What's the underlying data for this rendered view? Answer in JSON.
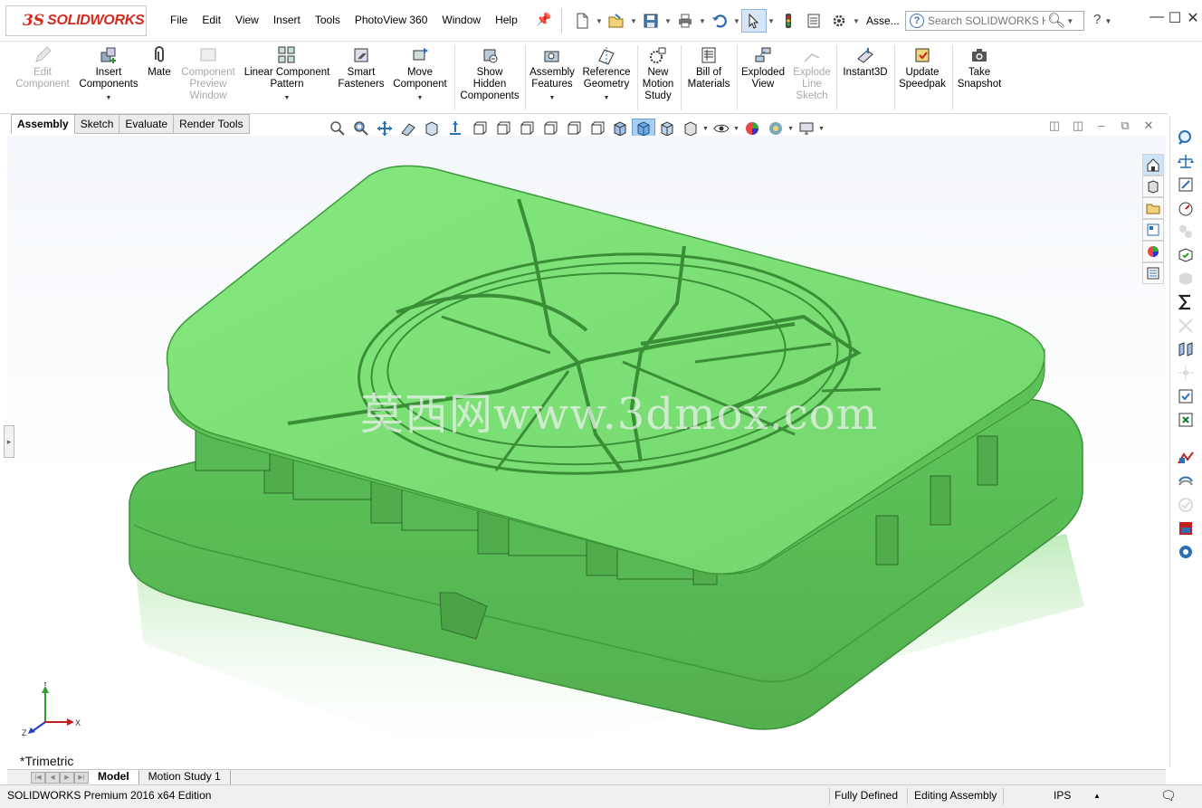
{
  "app": {
    "logo_ds": "3S",
    "logo_text": "SOLIDWORKS"
  },
  "menu": [
    "File",
    "Edit",
    "View",
    "Insert",
    "Tools",
    "PhotoView 360",
    "Window",
    "Help"
  ],
  "quick_access": {
    "document_label": "Asse..."
  },
  "search": {
    "placeholder": "Search SOLIDWORKS Help"
  },
  "command_manager": {
    "items": [
      {
        "label": "Edit\nComponent",
        "icon": "edit-component-icon",
        "enabled": false
      },
      {
        "label": "Insert\nComponents",
        "icon": "insert-components-icon",
        "enabled": true
      },
      {
        "label": "Mate",
        "icon": "mate-icon",
        "enabled": true
      },
      {
        "label": "Component\nPreview\nWindow",
        "icon": "component-preview-icon",
        "enabled": false
      },
      {
        "label": "Linear Component\nPattern",
        "icon": "linear-pattern-icon",
        "enabled": true
      },
      {
        "label": "Smart\nFasteners",
        "icon": "smart-fasteners-icon",
        "enabled": true
      },
      {
        "label": "Move\nComponent",
        "icon": "move-component-icon",
        "enabled": true
      },
      {
        "label": "Show\nHidden\nComponents",
        "icon": "show-hidden-icon",
        "enabled": true
      },
      {
        "label": "Assembly\nFeatures",
        "icon": "assembly-features-icon",
        "enabled": true
      },
      {
        "label": "Reference\nGeometry",
        "icon": "reference-geometry-icon",
        "enabled": true
      },
      {
        "label": "New\nMotion\nStudy",
        "icon": "new-motion-study-icon",
        "enabled": true
      },
      {
        "label": "Bill of\nMaterials",
        "icon": "bill-of-materials-icon",
        "enabled": true
      },
      {
        "label": "Exploded\nView",
        "icon": "exploded-view-icon",
        "enabled": true
      },
      {
        "label": "Explode\nLine\nSketch",
        "icon": "explode-line-sketch-icon",
        "enabled": false
      },
      {
        "label": "Instant3D",
        "icon": "instant3d-icon",
        "enabled": true
      },
      {
        "label": "Update\nSpeedpak",
        "icon": "update-speedpak-icon",
        "enabled": true
      },
      {
        "label": "Take\nSnapshot",
        "icon": "take-snapshot-icon",
        "enabled": true
      }
    ],
    "tabs": [
      "Assembly",
      "Sketch",
      "Evaluate",
      "Render Tools"
    ],
    "active_tab": "Assembly"
  },
  "graphics": {
    "watermark": "莫西网www.3dmox.com",
    "view_orientation": "*Trimetric",
    "model_color": "#7fe07a",
    "triad": {
      "x": "X",
      "y": "Y",
      "z": "Z"
    }
  },
  "bottom_tabs": [
    "Model",
    "Motion Study 1"
  ],
  "status": {
    "product": "SOLIDWORKS Premium 2016 x64 Edition",
    "definition": "Fully Defined",
    "mode": "Editing Assembly",
    "units": "IPS"
  }
}
